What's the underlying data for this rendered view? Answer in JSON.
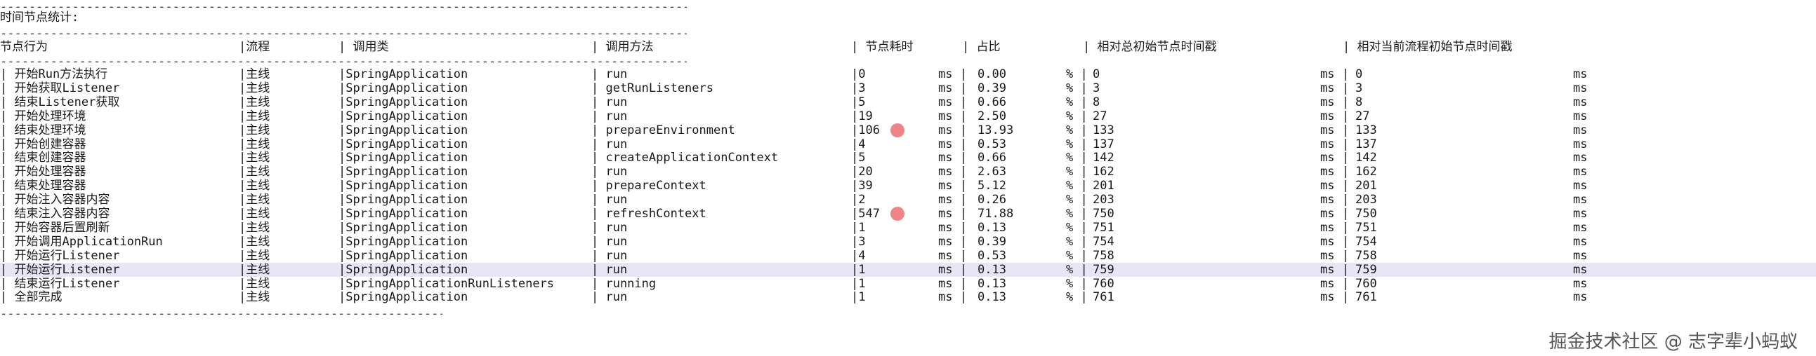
{
  "separator": "------------------------------------------------------------------------------------------------------------------------------------------------------------",
  "separator_short": "----------------------------------------------------------------------------------------------------",
  "title": "时间节点统计:",
  "columns": [
    "节点行为",
    "|流程",
    "| 调用类",
    "| 调用方法",
    "| 节点耗时",
    "| 占比",
    "| 相对总初始节点时间戳",
    "| 相对当前流程初始节点时间戳"
  ],
  "rows": [
    {
      "action": "| 开始Run方法执行",
      "flow": "|主线",
      "cls": "|SpringApplication",
      "method": "| run",
      "dur": "|0",
      "ms1": "ms |",
      "pct": "0.00",
      "pu": "% |",
      "total": "0",
      "ms2": "ms |",
      "cur": "0",
      "ms3": "ms"
    },
    {
      "action": "| 开始获取Listener",
      "flow": "|主线",
      "cls": "|SpringApplication",
      "method": "| getRunListeners",
      "dur": "|3",
      "ms1": "ms |",
      "pct": "0.39",
      "pu": "% |",
      "total": "3",
      "ms2": "ms |",
      "cur": "3",
      "ms3": "ms"
    },
    {
      "action": "| 结束Listener获取",
      "flow": "|主线",
      "cls": "|SpringApplication",
      "method": "| run",
      "dur": "|5",
      "ms1": "ms |",
      "pct": "0.66",
      "pu": "% |",
      "total": "8",
      "ms2": "ms |",
      "cur": "8",
      "ms3": "ms"
    },
    {
      "action": "| 开始处理环境",
      "flow": "|主线",
      "cls": "|SpringApplication",
      "method": "| run",
      "dur": "|19",
      "ms1": "ms |",
      "pct": "2.50",
      "pu": "% |",
      "total": "27",
      "ms2": "ms |",
      "cur": "27",
      "ms3": "ms"
    },
    {
      "action": "| 结束处理环境",
      "flow": "|主线",
      "cls": "|SpringApplication",
      "method": "| prepareEnvironment",
      "dur": "|106",
      "ms1": "ms |",
      "pct": "13.93",
      "pu": "% |",
      "total": "133",
      "ms2": "ms |",
      "cur": "133",
      "ms3": "ms",
      "marked": true
    },
    {
      "action": "| 开始创建容器",
      "flow": "|主线",
      "cls": "|SpringApplication",
      "method": "| run",
      "dur": "|4",
      "ms1": "ms |",
      "pct": "0.53",
      "pu": "% |",
      "total": "137",
      "ms2": "ms |",
      "cur": "137",
      "ms3": "ms"
    },
    {
      "action": "| 结束创建容器",
      "flow": "|主线",
      "cls": "|SpringApplication",
      "method": "| createApplicationContext",
      "dur": "|5",
      "ms1": "ms |",
      "pct": "0.66",
      "pu": "% |",
      "total": "142",
      "ms2": "ms |",
      "cur": "142",
      "ms3": "ms"
    },
    {
      "action": "| 开始处理容器",
      "flow": "|主线",
      "cls": "|SpringApplication",
      "method": "| run",
      "dur": "|20",
      "ms1": "ms |",
      "pct": "2.63",
      "pu": "% |",
      "total": "162",
      "ms2": "ms |",
      "cur": "162",
      "ms3": "ms"
    },
    {
      "action": "| 结束处理容器",
      "flow": "|主线",
      "cls": "|SpringApplication",
      "method": "| prepareContext",
      "dur": "|39",
      "ms1": "ms |",
      "pct": "5.12",
      "pu": "% |",
      "total": "201",
      "ms2": "ms |",
      "cur": "201",
      "ms3": "ms"
    },
    {
      "action": "| 开始注入容器内容",
      "flow": "|主线",
      "cls": "|SpringApplication",
      "method": "| run",
      "dur": "|2",
      "ms1": "ms |",
      "pct": "0.26",
      "pu": "% |",
      "total": "203",
      "ms2": "ms |",
      "cur": "203",
      "ms3": "ms"
    },
    {
      "action": "| 结束注入容器内容",
      "flow": "|主线",
      "cls": "|SpringApplication",
      "method": "| refreshContext",
      "dur": "|547",
      "ms1": "ms |",
      "pct": "71.88",
      "pu": "% |",
      "total": "750",
      "ms2": "ms |",
      "cur": "750",
      "ms3": "ms",
      "marked": true
    },
    {
      "action": "| 开始容器后置刷新",
      "flow": "|主线",
      "cls": "|SpringApplication",
      "method": "| run",
      "dur": "|1",
      "ms1": "ms |",
      "pct": "0.13",
      "pu": "% |",
      "total": "751",
      "ms2": "ms |",
      "cur": "751",
      "ms3": "ms"
    },
    {
      "action": "| 开始调用ApplicationRun",
      "flow": "|主线",
      "cls": "|SpringApplication",
      "method": "| run",
      "dur": "|3",
      "ms1": "ms |",
      "pct": "0.39",
      "pu": "% |",
      "total": "754",
      "ms2": "ms |",
      "cur": "754",
      "ms3": "ms"
    },
    {
      "action": "| 开始运行Listener",
      "flow": "|主线",
      "cls": "|SpringApplication",
      "method": "| run",
      "dur": "|4",
      "ms1": "ms |",
      "pct": "0.53",
      "pu": "% |",
      "total": "758",
      "ms2": "ms |",
      "cur": "758",
      "ms3": "ms"
    },
    {
      "action": "| 开始运行Listener",
      "flow": "|主线",
      "cls": "|SpringApplication",
      "method": "| run",
      "dur": "|1",
      "ms1": "ms |",
      "pct": "0.13",
      "pu": "% |",
      "total": "759",
      "ms2": "ms |",
      "cur": "759",
      "ms3": "ms",
      "selected": true
    },
    {
      "action": "| 结束运行Listener",
      "flow": "|主线",
      "cls": "|SpringApplicationRunListeners",
      "method": "| running",
      "dur": "|1",
      "ms1": "ms |",
      "pct": "0.13",
      "pu": "% |",
      "total": "760",
      "ms2": "ms |",
      "cur": "760",
      "ms3": "ms"
    },
    {
      "action": "| 全部完成",
      "flow": "|主线",
      "cls": "|SpringApplication",
      "method": "| run",
      "dur": "|1",
      "ms1": "ms |",
      "pct": "0.13",
      "pu": "% |",
      "total": "761",
      "ms2": "ms |",
      "cur": "761",
      "ms3": "ms"
    }
  ],
  "watermark": "掘金技术社区 @ 志字辈小蚂蚁",
  "colors": {
    "highlight_dot": "#ee8487",
    "selected_row": "#e6e6f7"
  }
}
